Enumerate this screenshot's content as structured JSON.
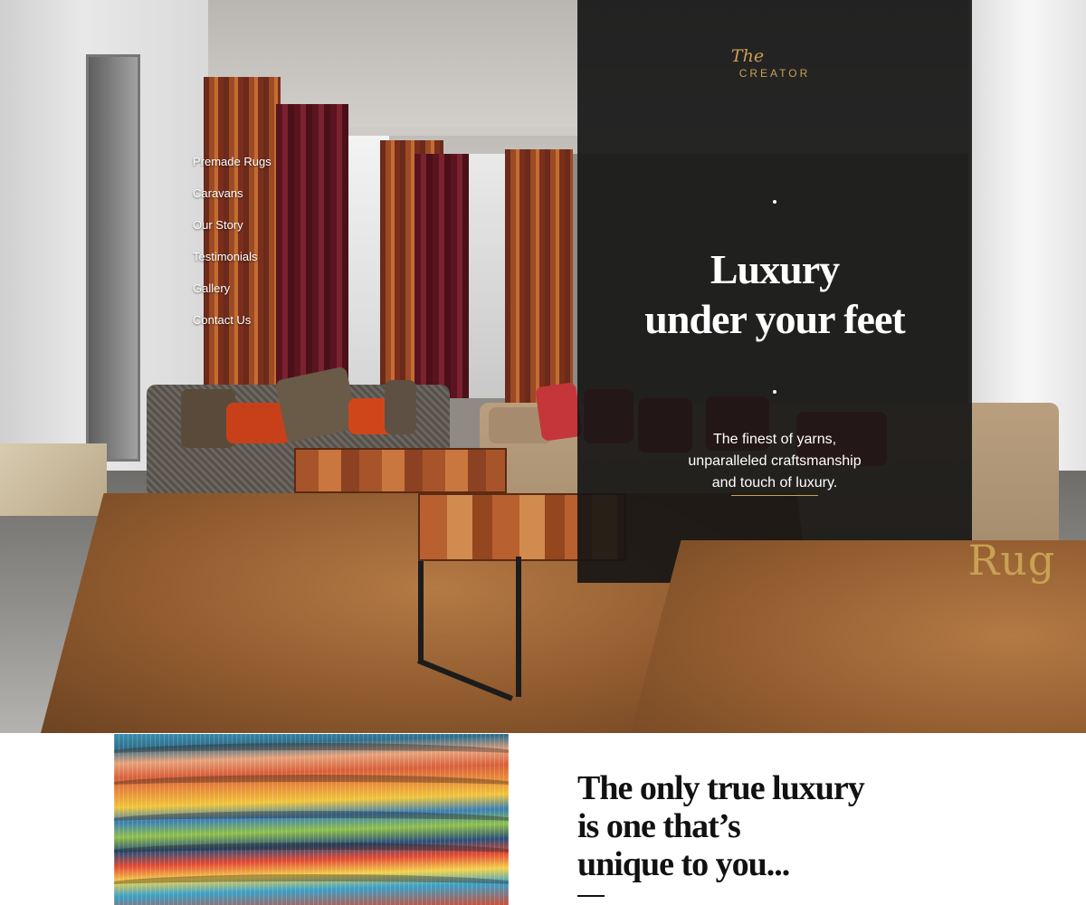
{
  "brand": {
    "logo_the": "The",
    "logo_rug": "Rug",
    "logo_creator": "CREATOR",
    "accent_color": "#c9a154"
  },
  "nav": {
    "items": [
      {
        "label": "Premade Rugs"
      },
      {
        "label": "Caravans"
      },
      {
        "label": "Our Story"
      },
      {
        "label": "Testimonials"
      },
      {
        "label": "Gallery"
      },
      {
        "label": "Contact Us"
      }
    ]
  },
  "hero": {
    "headline_line1": "Luxury",
    "headline_line2": "under your feet",
    "tagline_line1": "The finest of yarns,",
    "tagline_line2": "unparalleled craftsmanship",
    "tagline_line3": "and touch of luxury.",
    "panel_color": "#141414"
  },
  "intro": {
    "quote_line1": "The only true luxury",
    "quote_line2": "is one that’s",
    "quote_line3": "unique to you..."
  }
}
